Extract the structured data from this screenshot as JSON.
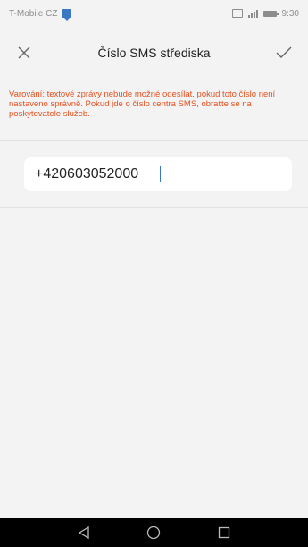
{
  "status_bar": {
    "carrier": "T-Mobile CZ",
    "time": "9:30"
  },
  "app_bar": {
    "title": "Číslo SMS střediska",
    "close_icon": "close-icon",
    "confirm_icon": "check-icon"
  },
  "warning_text": "Varování: textové zprávy nebude možné odesílat, pokud toto číslo není nastaveno správně. Pokud jde o číslo centra SMS, obraťte se na poskytovatele služeb.",
  "sms_center_number": "+420603052000",
  "nav_bar": {
    "back_icon": "back-triangle-icon",
    "home_icon": "home-circle-icon",
    "recents_icon": "recents-square-icon"
  },
  "colors": {
    "background": "#f3f3f3",
    "warning": "#e8501f",
    "cursor": "#3a77c4",
    "nav_bar": "#000000"
  }
}
